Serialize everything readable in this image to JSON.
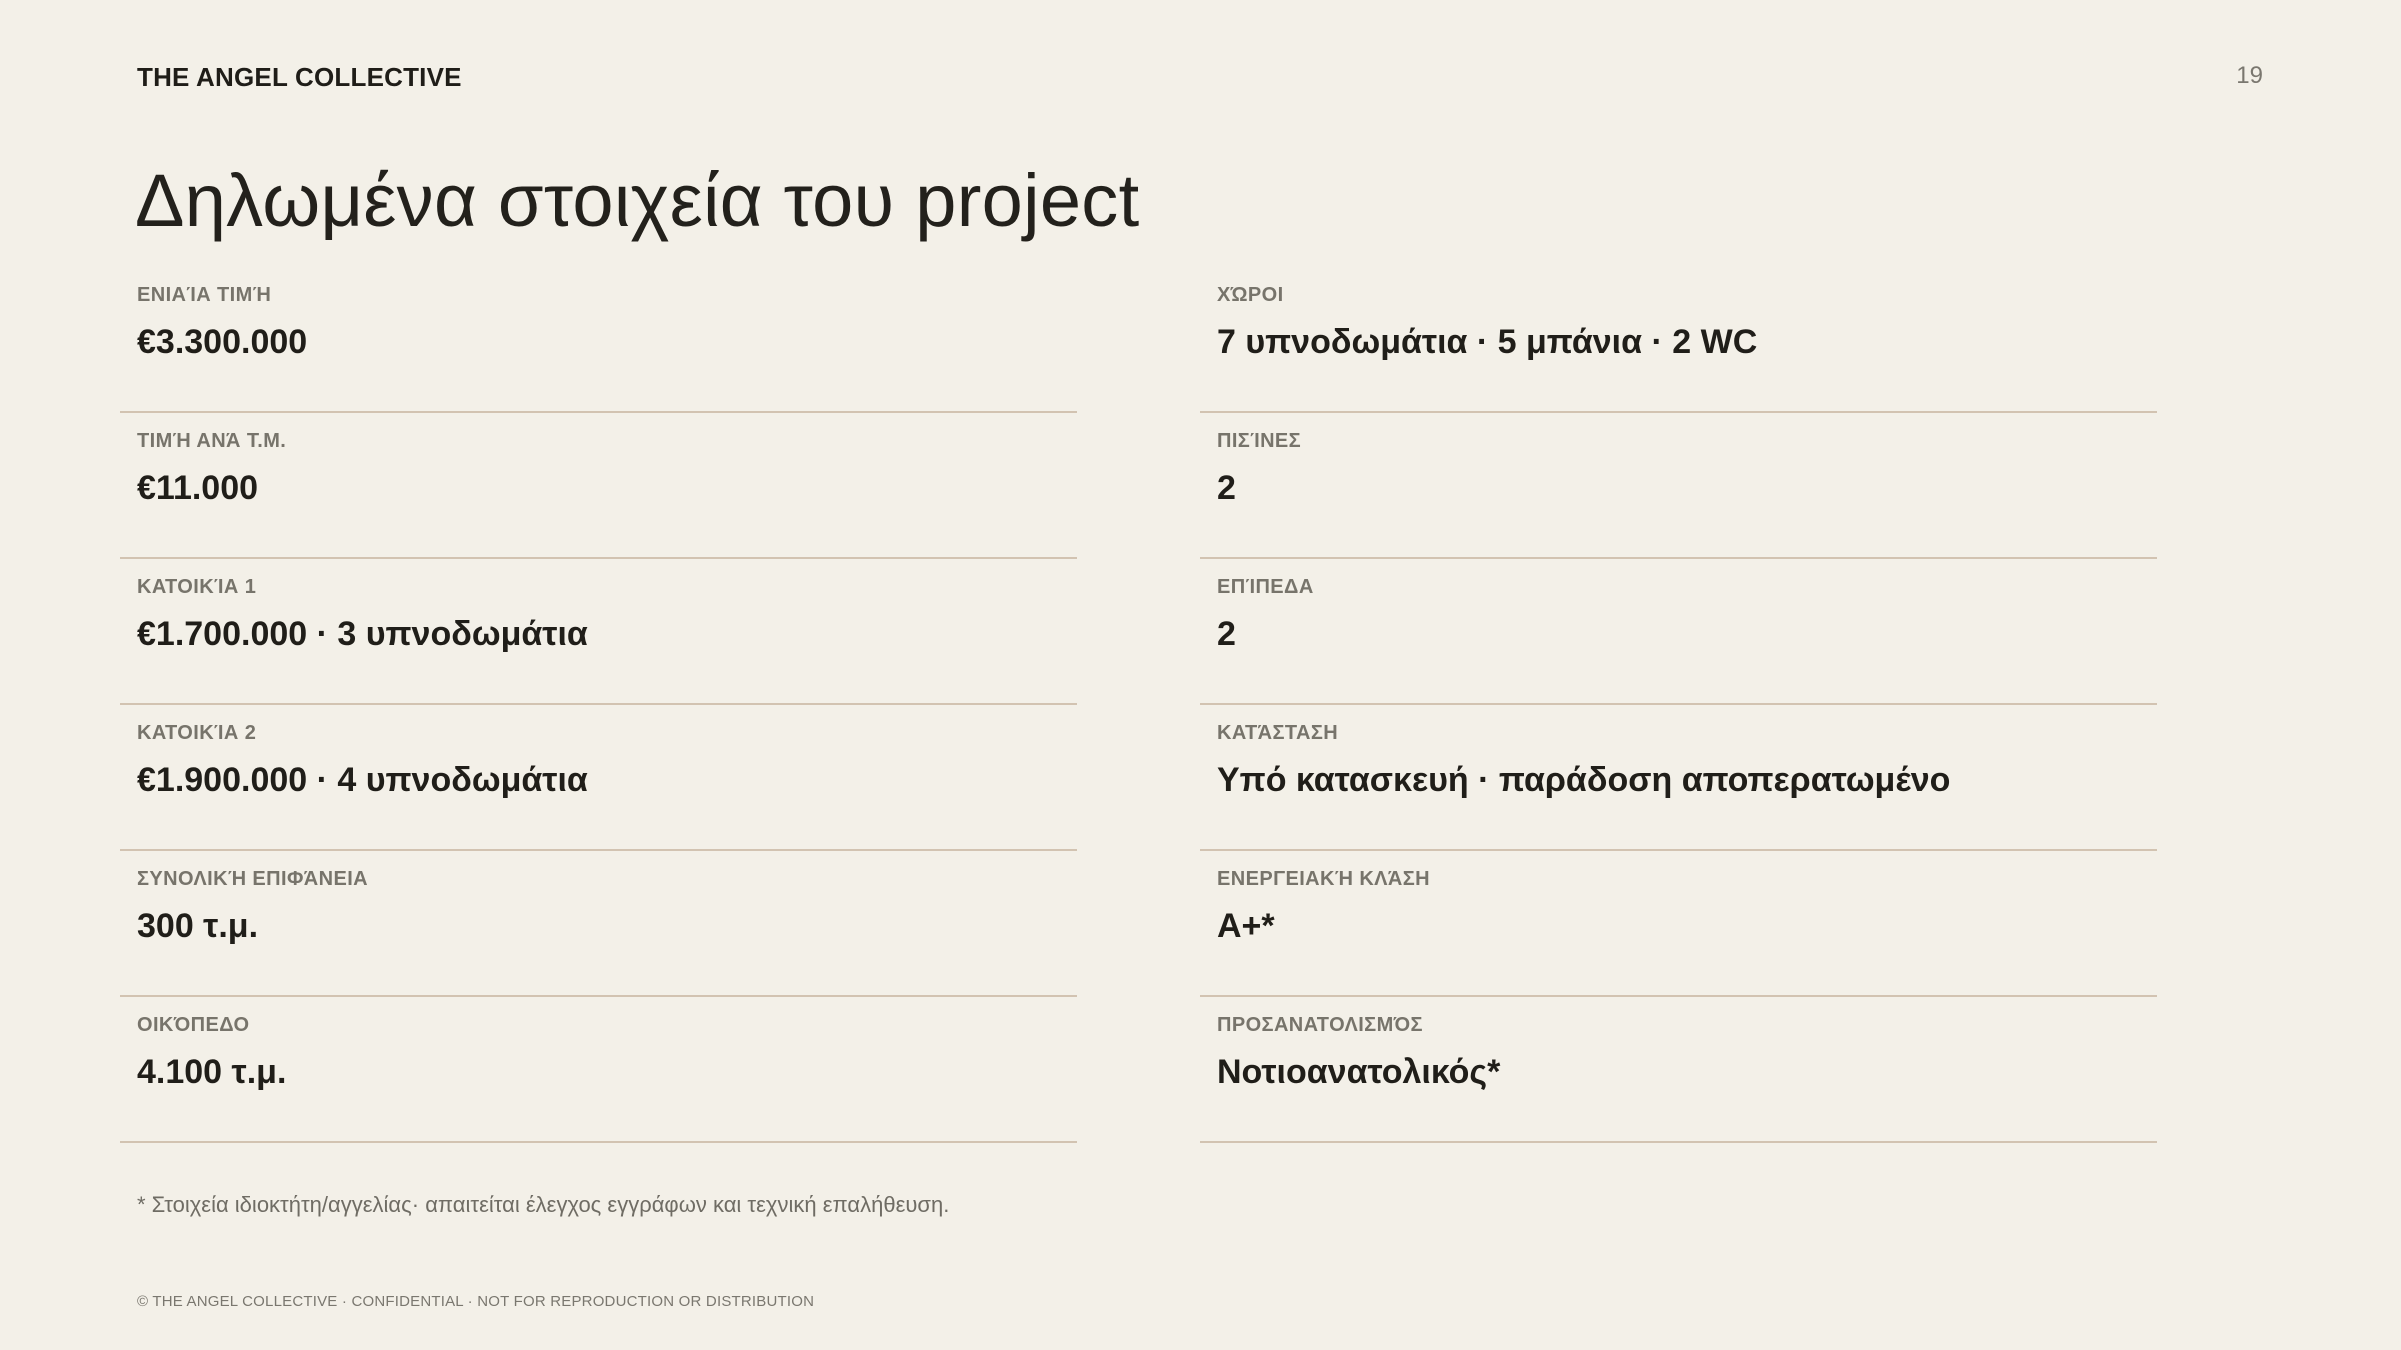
{
  "header": {
    "brand": "THE ANGEL COLLECTIVE",
    "page_number": "19"
  },
  "title": "Δηλωμένα στοιχεία του project",
  "left_fields": [
    {
      "label": "ΕΝΙΑΊΑ ΤΙΜΉ",
      "value": "€3.300.000"
    },
    {
      "label": "ΤΙΜΉ ΑΝΆ Τ.Μ.",
      "value": "€11.000"
    },
    {
      "label": "ΚΑΤΟΙΚΊΑ 1",
      "value": "€1.700.000 · 3 υπνοδωμάτια"
    },
    {
      "label": "ΚΑΤΟΙΚΊΑ 2",
      "value": "€1.900.000 · 4 υπνοδωμάτια"
    },
    {
      "label": "ΣΥΝΟΛΙΚΉ ΕΠΙΦΆΝΕΙΑ",
      "value": "300 τ.μ."
    },
    {
      "label": "ΟΙΚΌΠΕΔΟ",
      "value": "4.100 τ.μ."
    }
  ],
  "right_fields": [
    {
      "label": "ΧΏΡΟΙ",
      "value": "7 υπνοδωμάτια · 5 μπάνια · 2 WC"
    },
    {
      "label": "ΠΙΣΊΝΕΣ",
      "value": "2"
    },
    {
      "label": "ΕΠΊΠΕΔΑ",
      "value": "2"
    },
    {
      "label": "ΚΑΤΆΣΤΑΣΗ",
      "value": "Υπό κατασκευή · παράδοση αποπερατωμένο"
    },
    {
      "label": "ΕΝΕΡΓΕΙΑΚΉ ΚΛΆΣΗ",
      "value": "A+*"
    },
    {
      "label": "ΠΡΟΣΑΝΑΤΟΛΙΣΜΌΣ",
      "value": "Νοτιοανατολικός*"
    }
  ],
  "footnote": "* Στοιχεία ιδιοκτήτη/αγγελίας· απαιτείται έλεγχος εγγράφων και τεχνική επαλήθευση.",
  "footer": "© THE ANGEL COLLECTIVE · CONFIDENTIAL · NOT FOR REPRODUCTION OR DISTRIBUTION"
}
